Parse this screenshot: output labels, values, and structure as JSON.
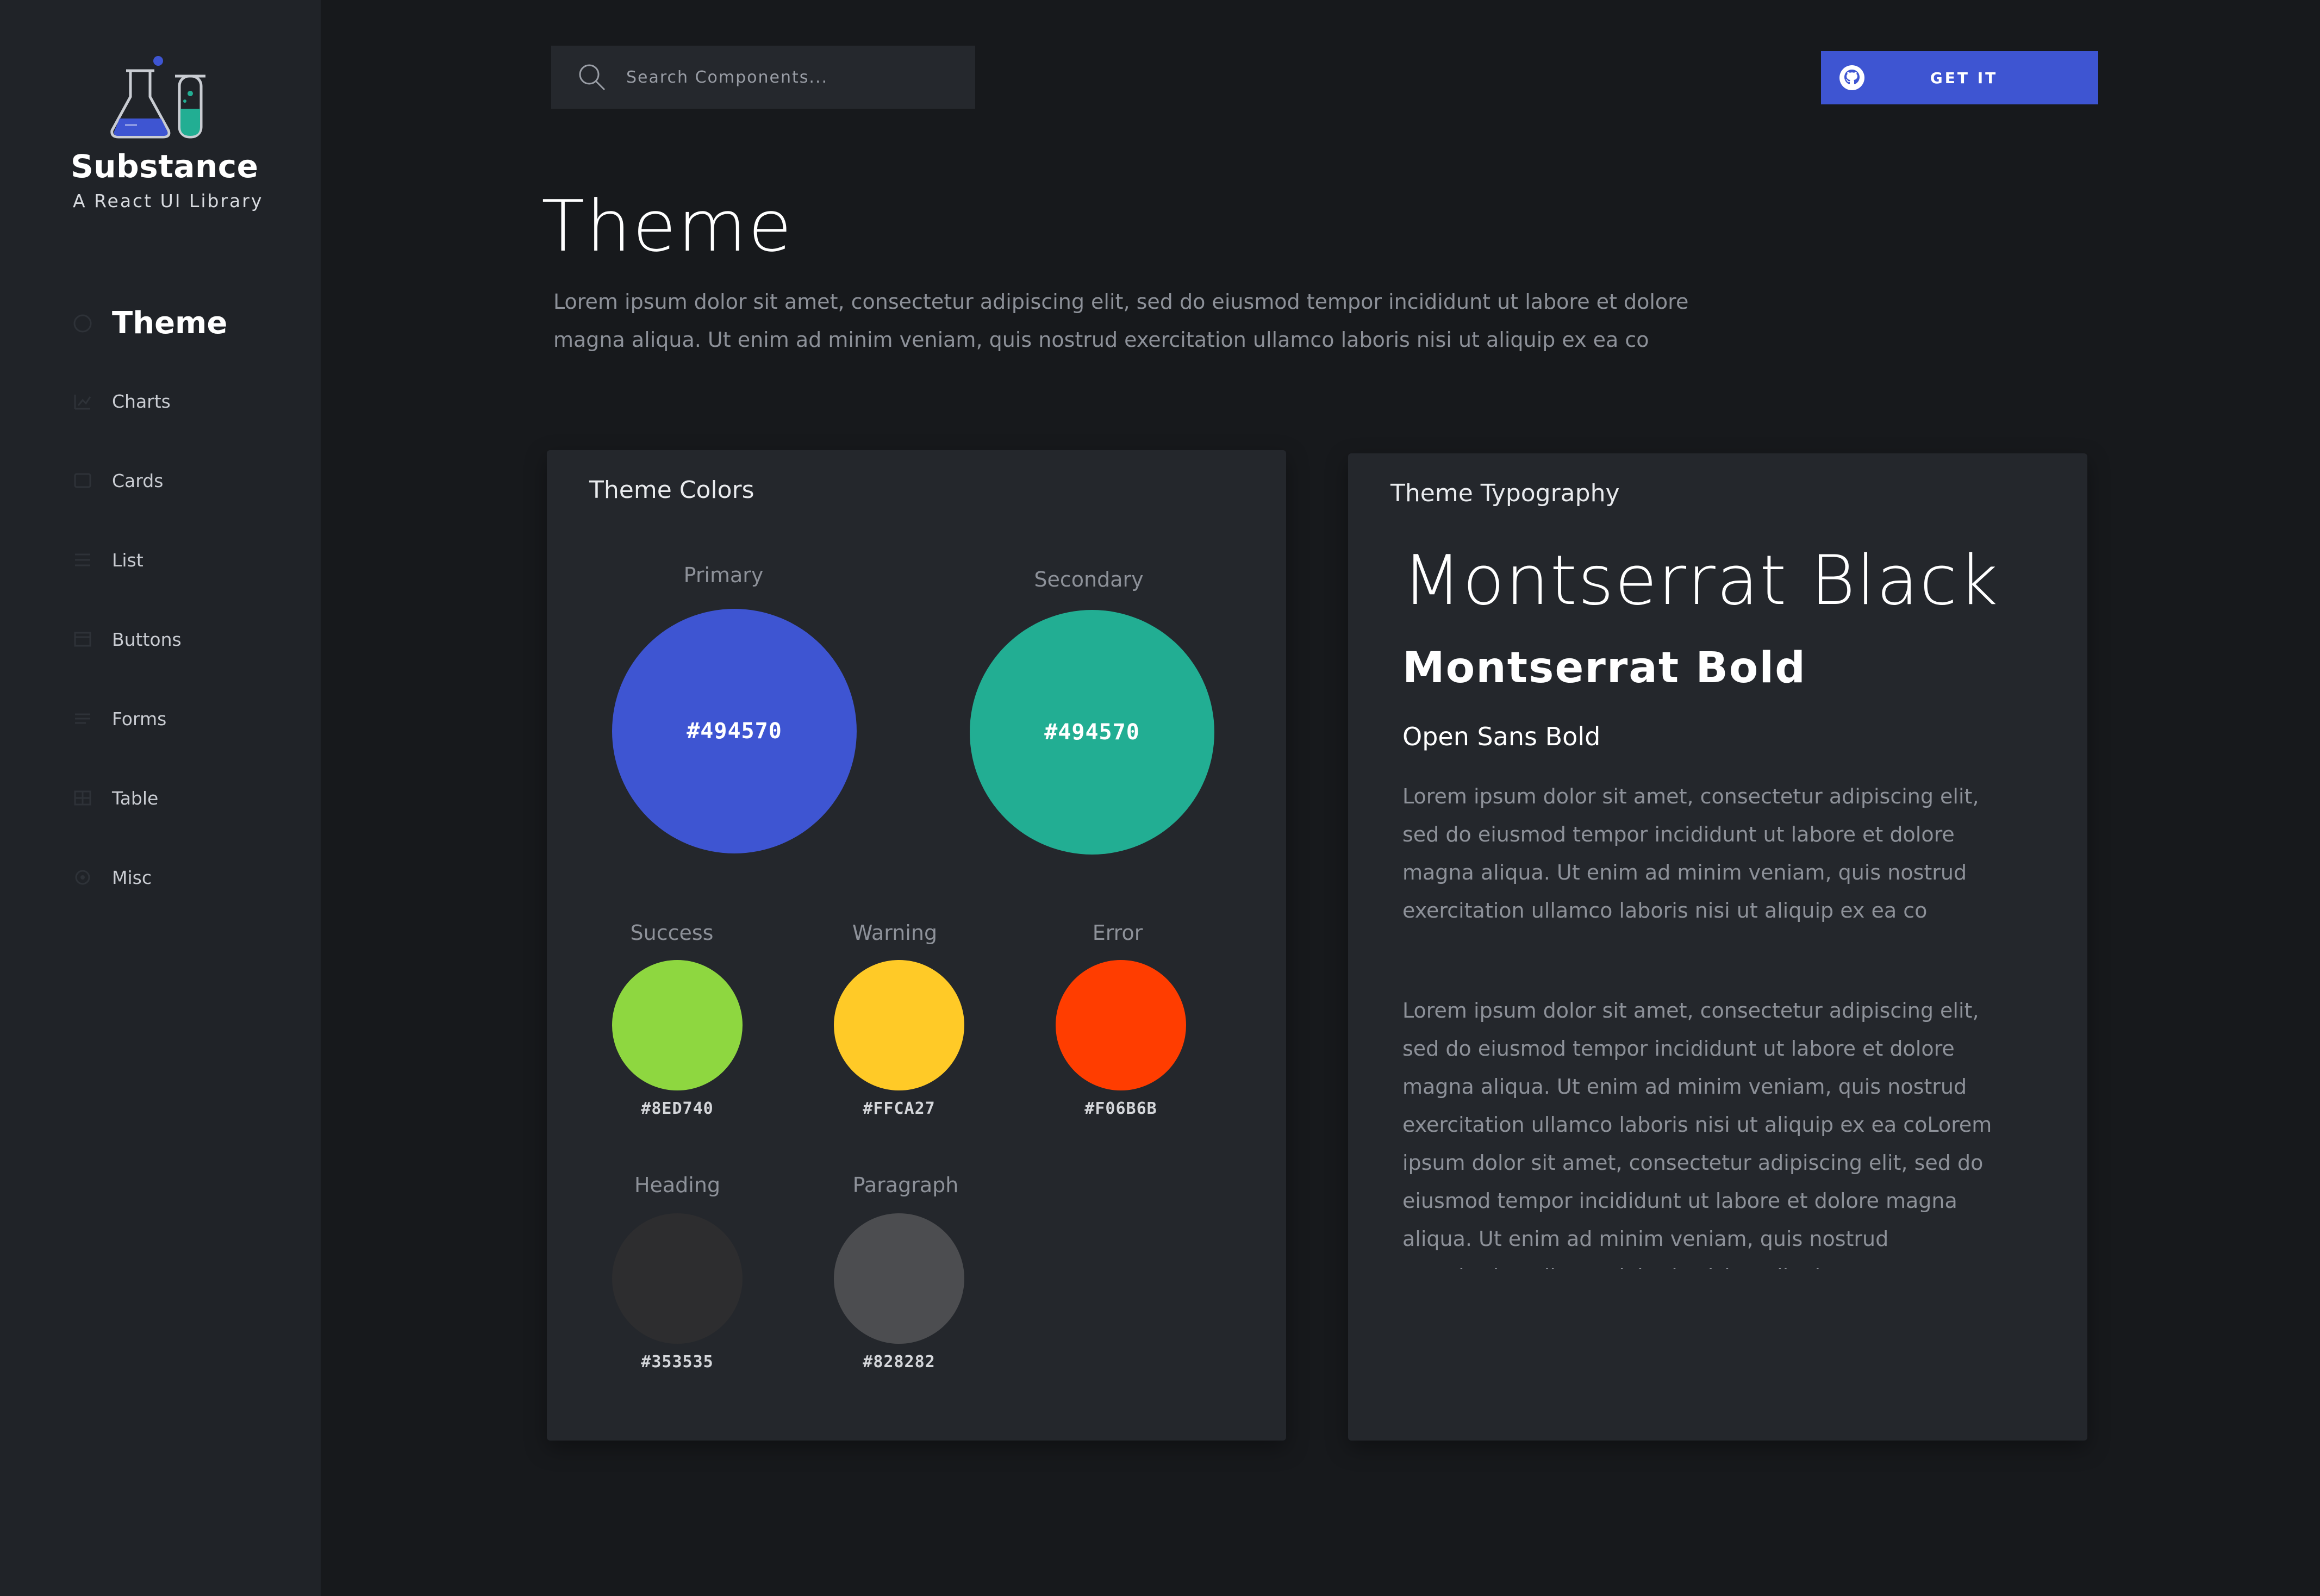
{
  "app": {
    "name": "Substance",
    "tagline": "A React UI Library"
  },
  "sidebar": {
    "items": [
      {
        "label": "Theme",
        "icon": "palette-icon",
        "active": true
      },
      {
        "label": "Charts",
        "icon": "chart-icon"
      },
      {
        "label": "Cards",
        "icon": "cards-icon"
      },
      {
        "label": "List",
        "icon": "list-icon"
      },
      {
        "label": "Buttons",
        "icon": "buttons-icon"
      },
      {
        "label": "Forms",
        "icon": "forms-icon"
      },
      {
        "label": "Table",
        "icon": "table-icon"
      },
      {
        "label": "Misc",
        "icon": "misc-icon"
      }
    ]
  },
  "search": {
    "placeholder": "Search Components..."
  },
  "github_button": {
    "label": "GET IT",
    "icon": "github-icon",
    "color": "#3e55d2"
  },
  "header": {
    "title": "Theme",
    "description": "Lorem ipsum dolor sit amet, consectetur adipiscing elit, sed do eiusmod tempor incididunt ut labore et dolore magna aliqua. Ut enim ad minim veniam, quis nostrud exercitation ullamco laboris nisi ut aliquip ex ea co"
  },
  "theme_colors": {
    "title": "Theme Colors",
    "primary": {
      "label": "Primary",
      "hex": "#494570",
      "color": "#3e55d2"
    },
    "secondary": {
      "label": "Secondary",
      "hex": "#494570",
      "color": "#22ae93"
    },
    "success": {
      "label": "Success",
      "hex": "#8ED740",
      "color": "#8ed740"
    },
    "warning": {
      "label": "Warning",
      "hex": "#FFCA27",
      "color": "#ffca27"
    },
    "error": {
      "label": "Error",
      "hex": "#F06B6B",
      "color": "#ff3d00"
    },
    "heading": {
      "label": "Heading",
      "hex": "#353535",
      "color": "#2d2d2f"
    },
    "paragraph": {
      "label": "Paragraph",
      "hex": "#828282",
      "color": "#4c4d50"
    }
  },
  "theme_typography": {
    "title": "Theme Typography",
    "sample_black": "Montserrat Black",
    "sample_bold": "Montserrat Bold",
    "sample_opensans": "Open Sans Bold",
    "paragraph_1": "Lorem ipsum dolor sit amet, consectetur adipiscing elit, sed do eiusmod tempor incididunt ut labore et dolore magna aliqua. Ut enim ad minim veniam, quis nostrud exercitation ullamco laboris nisi ut aliquip ex ea co",
    "paragraph_2": "Lorem ipsum dolor sit amet, consectetur adipiscing elit, sed do eiusmod tempor incididunt ut labore et dolore magna aliqua. Ut enim ad minim veniam, quis nostrud exercitation ullamco laboris nisi ut aliquip ex ea coLorem ipsum dolor sit amet, consectetur adipiscing elit, sed do eiusmod tempor incididunt ut labore et dolore magna aliqua. Ut enim ad minim veniam, quis nostrud exercitation ullamco laboris nisi ut aliquip ex ea co"
  }
}
